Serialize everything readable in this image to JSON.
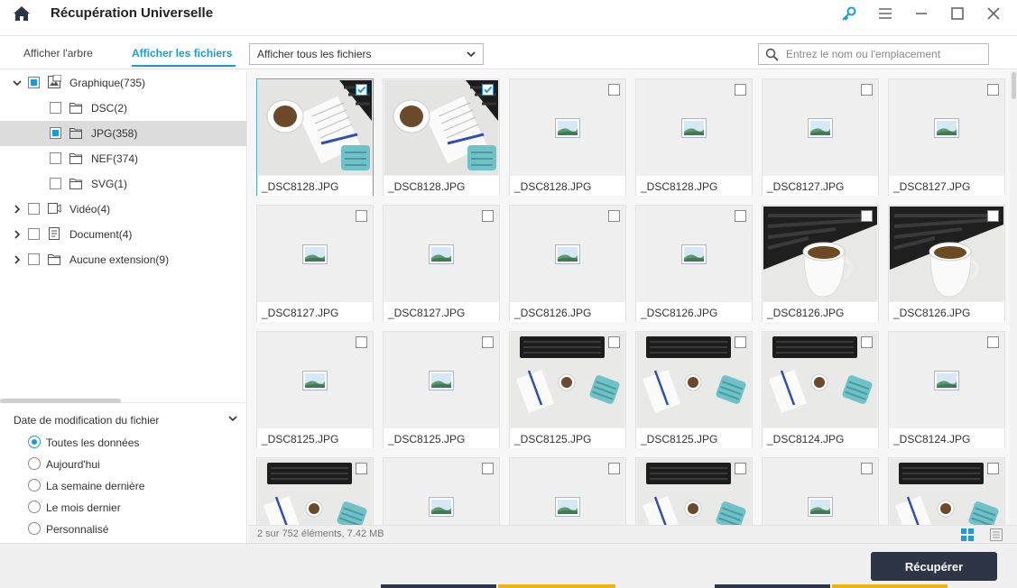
{
  "app": {
    "title": "Récupération Universelle"
  },
  "toolbar": {
    "tab_tree": "Afficher l'arbre",
    "tab_files": "Afficher les fichiers",
    "filter_value": "Afficher tous les fichiers",
    "search_placeholder": "Entrez le nom ou l'emplacement"
  },
  "tree": [
    {
      "label": "Graphique(735)",
      "expanded": true,
      "check": "partial",
      "icon": "image-folder-icon"
    },
    {
      "label": "DSC(2)",
      "check": "none",
      "icon": "folder-icon"
    },
    {
      "label": "JPG(358)",
      "check": "partial",
      "selected": true,
      "icon": "folder-icon"
    },
    {
      "label": "NEF(374)",
      "check": "none",
      "icon": "folder-icon"
    },
    {
      "label": "SVG(1)",
      "check": "none",
      "icon": "folder-icon"
    },
    {
      "label": "Vidéo(4)",
      "expanded": false,
      "check": "none",
      "icon": "video-folder-icon"
    },
    {
      "label": "Document(4)",
      "expanded": false,
      "check": "none",
      "icon": "document-folder-icon"
    },
    {
      "label": "Aucune extension(9)",
      "expanded": false,
      "check": "none",
      "icon": "folder-icon"
    }
  ],
  "date_filter": {
    "title": "Date de modification du fichier",
    "options": [
      "Toutes les données",
      "Aujourd'hui",
      "La semaine dernière",
      "Le mois dernier",
      "Personnalisé"
    ],
    "selected": "Toutes les données"
  },
  "files": [
    {
      "name": "_DSC8128.JPG",
      "thumb": "mug-notebook-keyboard",
      "checked": true
    },
    {
      "name": "_DSC8128.JPG",
      "thumb": "mug-notebook-keyboard",
      "checked": true
    },
    {
      "name": "_DSC8128.JPG",
      "thumb": "placeholder",
      "checked": false
    },
    {
      "name": "_DSC8128.JPG",
      "thumb": "placeholder",
      "checked": false
    },
    {
      "name": "_DSC8127.JPG",
      "thumb": "placeholder",
      "checked": false
    },
    {
      "name": "_DSC8127.JPG",
      "thumb": "placeholder",
      "checked": false
    },
    {
      "name": "_DSC8127.JPG",
      "thumb": "placeholder",
      "checked": false
    },
    {
      "name": "_DSC8127.JPG",
      "thumb": "placeholder",
      "checked": false
    },
    {
      "name": "_DSC8126.JPG",
      "thumb": "placeholder",
      "checked": false
    },
    {
      "name": "_DSC8126.JPG",
      "thumb": "placeholder",
      "checked": false
    },
    {
      "name": "_DSC8126.JPG",
      "thumb": "mug-keyboard",
      "checked": false
    },
    {
      "name": "_DSC8126.JPG",
      "thumb": "mug-keyboard",
      "checked": false
    },
    {
      "name": "_DSC8125.JPG",
      "thumb": "placeholder",
      "checked": false
    },
    {
      "name": "_DSC8125.JPG",
      "thumb": "placeholder",
      "checked": false
    },
    {
      "name": "_DSC8125.JPG",
      "thumb": "desk-flatlay",
      "checked": false
    },
    {
      "name": "_DSC8125.JPG",
      "thumb": "desk-flatlay",
      "checked": false
    },
    {
      "name": "_DSC8124.JPG",
      "thumb": "desk-flatlay",
      "checked": false
    },
    {
      "name": "_DSC8124.JPG",
      "thumb": "placeholder",
      "checked": false
    },
    {
      "name": "",
      "thumb": "desk-flatlay",
      "checked": false
    },
    {
      "name": "",
      "thumb": "placeholder",
      "checked": false
    },
    {
      "name": "",
      "thumb": "placeholder",
      "checked": false
    },
    {
      "name": "",
      "thumb": "desk-flatlay-apple",
      "checked": false
    },
    {
      "name": "",
      "thumb": "placeholder",
      "checked": false
    },
    {
      "name": "",
      "thumb": "desk-flatlay-apple",
      "checked": false
    }
  ],
  "status": {
    "text": "2 sur 752 éléments, 7.42  MB"
  },
  "actions": {
    "recover_label": "Récupérer"
  },
  "colors": {
    "accent": "#1a9ad8",
    "primary_button": "#2d3546"
  }
}
